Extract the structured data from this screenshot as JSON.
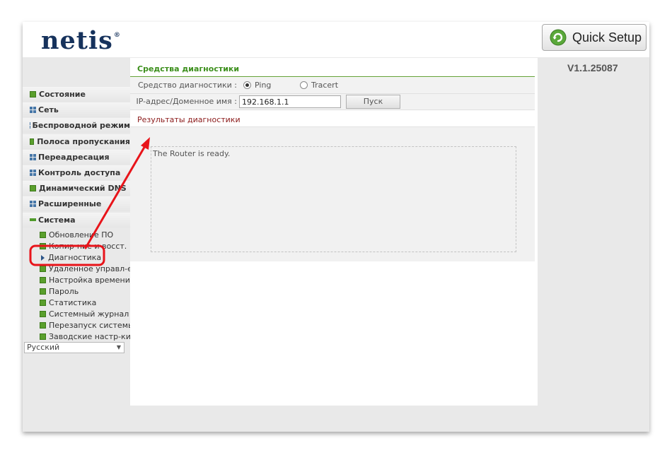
{
  "header": {
    "logo_text": "netis",
    "logo_mark": "®",
    "quick_setup_label": "Quick Setup",
    "version": "V1.1.25087"
  },
  "sidebar": {
    "items": [
      {
        "label": "Состояние",
        "icon": "green-square-icon"
      },
      {
        "label": "Сеть",
        "icon": "blue-grid-icon"
      },
      {
        "label": "Беспроводной режим",
        "icon": "blue-grid-icon"
      },
      {
        "label": "Полоса пропускания",
        "icon": "green-square-icon"
      },
      {
        "label": "Переадресация",
        "icon": "blue-grid-icon"
      },
      {
        "label": "Контроль доступа",
        "icon": "blue-grid-icon"
      },
      {
        "label": "Динамический DNS",
        "icon": "green-square-icon"
      },
      {
        "label": "Расширенные",
        "icon": "blue-grid-icon"
      },
      {
        "label": "Система",
        "icon": "minus-icon"
      }
    ],
    "system_subitems": [
      {
        "label": "Обновление ПО"
      },
      {
        "label": "Копир-ние и восст."
      },
      {
        "label": "Диагностика",
        "selected": true
      },
      {
        "label": "Удаленное управл-е"
      },
      {
        "label": "Настройка времени"
      },
      {
        "label": "Пароль"
      },
      {
        "label": "Статистика"
      },
      {
        "label": "Системный журнал"
      },
      {
        "label": "Перезапуск системы"
      },
      {
        "label": "Заводские настр-ки"
      }
    ],
    "language": "Русский"
  },
  "content": {
    "section_title": "Средства диагностики",
    "tool_label": "Средство диагностики :",
    "tool_options": [
      "Ping",
      "Tracert"
    ],
    "tool_selected": "Ping",
    "ip_label": "IP-адрес/Доменное имя :",
    "ip_value": "192.168.1.1",
    "start_button": "Пуск",
    "results_title": "Результаты диагностики",
    "results_text": "The Router is ready."
  },
  "colors": {
    "accent_green": "#3c8f1c",
    "results_title": "#8b1a1a",
    "annotation_red": "#e8141a",
    "logo_navy": "#16325c"
  }
}
